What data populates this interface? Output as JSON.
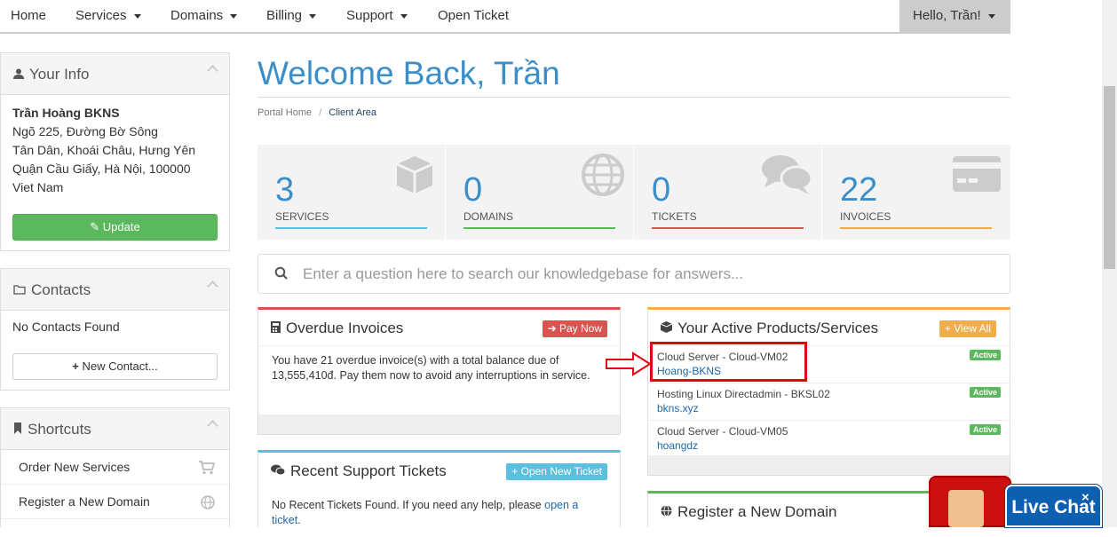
{
  "nav": {
    "home": "Home",
    "services": "Services",
    "domains": "Domains",
    "billing": "Billing",
    "support": "Support",
    "open_ticket": "Open Ticket",
    "user": "Hello, Trần!"
  },
  "sidebar": {
    "your_info": {
      "title": "Your Info",
      "name": "Trần Hoàng BKNS",
      "address1": "Ngõ 225, Đường Bờ Sông",
      "address2": "Tân Dân, Khoái Châu, Hưng Yên",
      "address3": "Quận Cầu Giấy, Hà Nội, 100000",
      "country": "Viet Nam",
      "update_label": "Update"
    },
    "contacts": {
      "title": "Contacts",
      "empty": "No Contacts Found",
      "new_label": "New Contact..."
    },
    "shortcuts": {
      "title": "Shortcuts",
      "items": [
        {
          "label": "Order New Services",
          "icon": "cart-icon"
        },
        {
          "label": "Register a New Domain",
          "icon": "globe-icon"
        }
      ]
    }
  },
  "main": {
    "title": "Welcome Back, Trần",
    "breadcrumb": [
      "Portal Home",
      "Client Area"
    ],
    "tiles": [
      {
        "count": "3",
        "label": "SERVICES",
        "color": "#5bc0de",
        "icon": "cube-icon"
      },
      {
        "count": "0",
        "label": "DOMAINS",
        "color": "#5cb85c",
        "icon": "globe-icon"
      },
      {
        "count": "0",
        "label": "TICKETS",
        "color": "#d9534f",
        "icon": "comments-icon"
      },
      {
        "count": "22",
        "label": "INVOICES",
        "color": "#f0ad4e",
        "icon": "credit-card-icon"
      }
    ],
    "search": {
      "placeholder": "Enter a question here to search our knowledgebase for answers..."
    },
    "overdue": {
      "title": "Overdue Invoices",
      "button": "Pay Now",
      "text": "You have 21 overdue invoice(s) with a total balance due of 13,555,410đ. Pay them now to avoid any interruptions in service.",
      "accent": "#d9534f"
    },
    "tickets": {
      "title": "Recent Support Tickets",
      "button": "Open New Ticket",
      "text_before": "No Recent Tickets Found. If you need any help, please",
      "link": "open a ticket",
      "text_after": ".",
      "accent": "#5bc0de"
    },
    "products": {
      "title": "Your Active Products/Services",
      "button": "View All",
      "accent": "#f0ad4e",
      "items": [
        {
          "name": "Cloud Server - Cloud-VM02",
          "domain": "Hoang-BKNS",
          "status": "Active"
        },
        {
          "name": "Hosting Linux Directadmin - BKSL02",
          "domain": "bkns.xyz",
          "status": "Active"
        },
        {
          "name": "Cloud Server - Cloud-VM05",
          "domain": "hoangdz",
          "status": "Active"
        }
      ]
    },
    "register_domain": {
      "title": "Register a New Domain",
      "accent": "#5cb85c"
    }
  },
  "chat": {
    "label": "Live Chat",
    "close": "×"
  }
}
